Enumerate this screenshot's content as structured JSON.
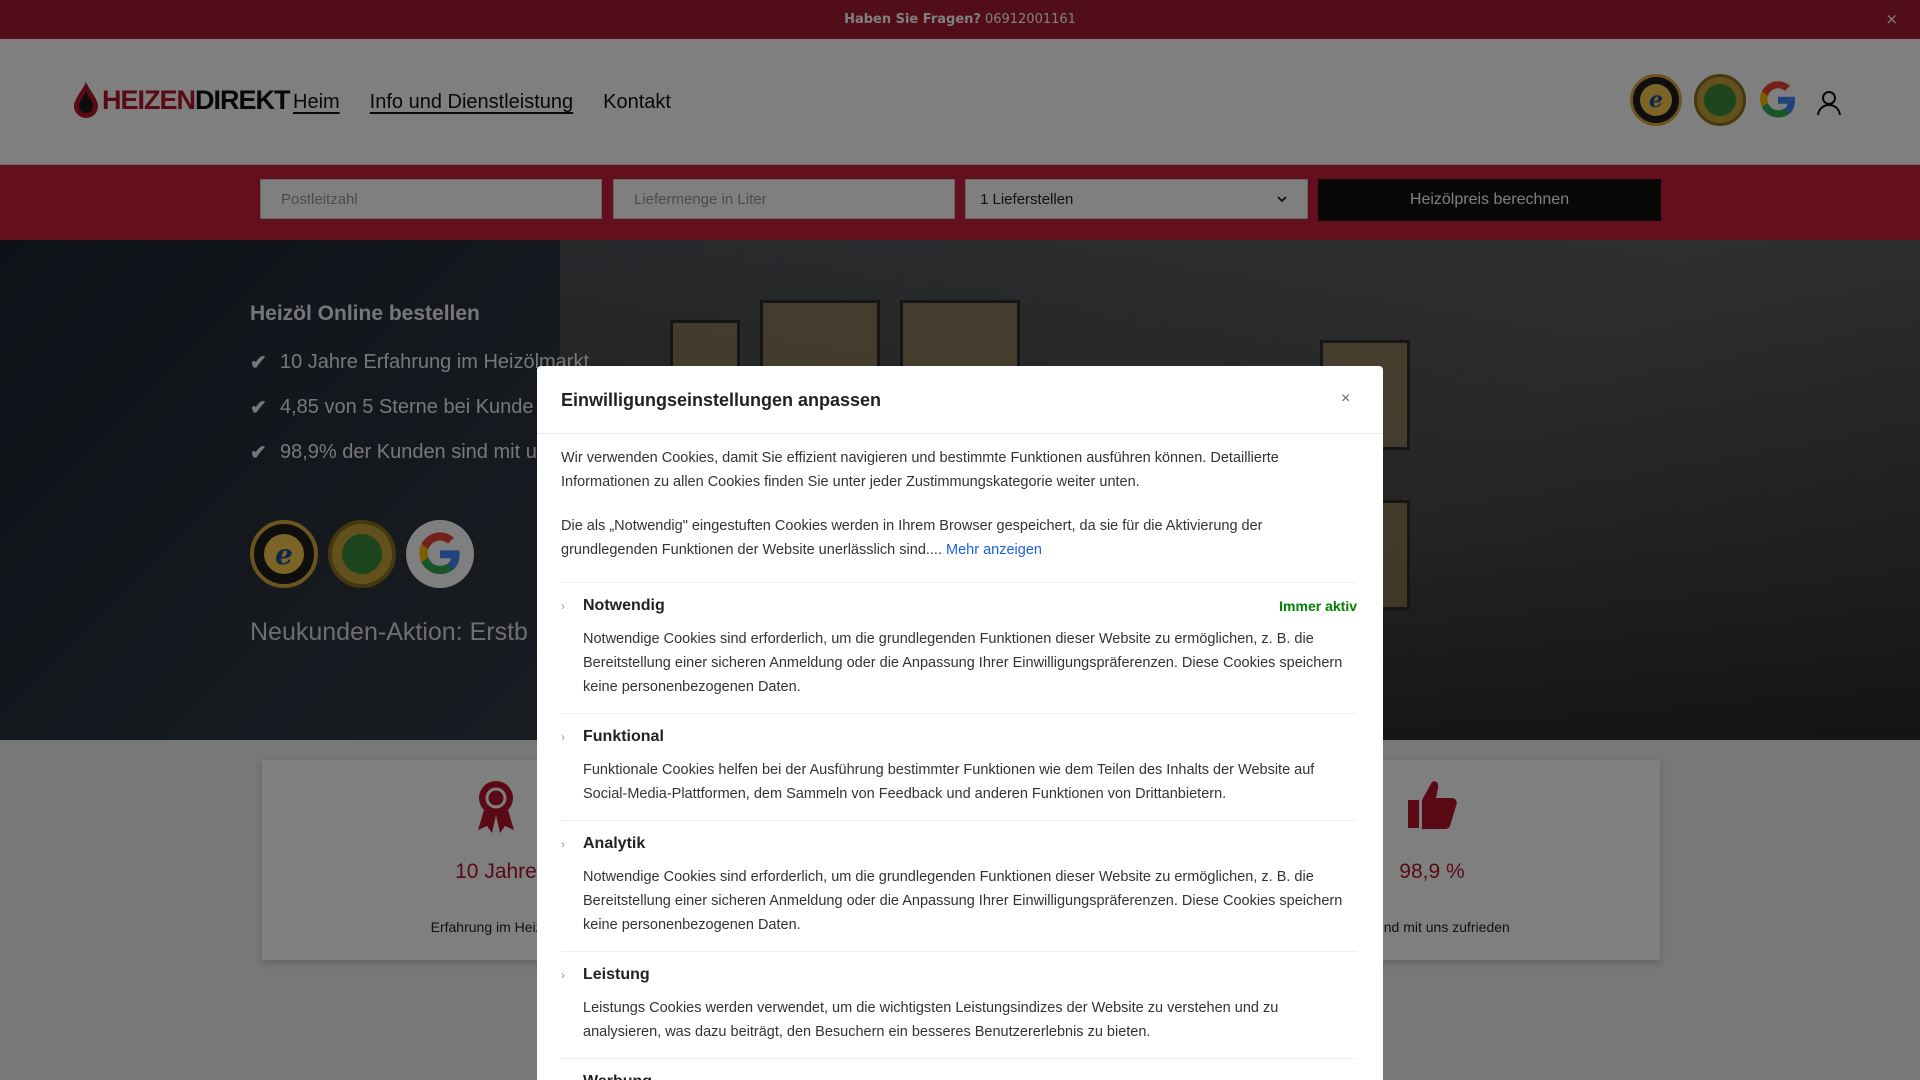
{
  "topbar": {
    "question": "Haben Sie Fragen?",
    "phone": "06912001161",
    "close": "×"
  },
  "header": {
    "brand_part1": "HEIZEN",
    "brand_part2": "DIREKT",
    "nav": [
      {
        "label": "Heim"
      },
      {
        "label": "Info und Dienstleistung"
      },
      {
        "label": "Kontakt"
      }
    ]
  },
  "search": {
    "zip_placeholder": "Postleitzahl",
    "amount_placeholder": "Liefermenge in Liter",
    "delivery_points": "1 Lieferstellen",
    "button": "Heizölpreis berechnen"
  },
  "hero": {
    "heading": "Heizöl Online bestellen",
    "bullets": [
      "10 Jahre Erfahrung im Heizölmarkt",
      "4,85 von 5 Sterne bei Kunde",
      "98,9% der Kunden sind mit u"
    ],
    "promo": "Neukunden-Aktion: Erstb",
    "check": "✔"
  },
  "stats": [
    {
      "value": "10 Jahre",
      "desc": "Erfahrung im Heizöln"
    },
    {
      "value": "98,9 %",
      "desc": "en sind mit uns zufrieden"
    }
  ],
  "modal": {
    "title": "Einwilligungseinstellungen anpassen",
    "close": "×",
    "intro1": "Wir verwenden Cookies, damit Sie effizient navigieren und bestimmte Funktionen ausführen können. Detaillierte Informationen zu allen Cookies finden Sie unter jeder Zustimmungskategorie weiter unten.",
    "intro2": "Die als „Notwendig\" eingestuften Cookies werden in Ihrem Browser gespeichert, da sie für die Aktivierung der grundlegenden Funktionen der Website unerlässlich sind....",
    "more": "Mehr anzeigen",
    "always_active": "Immer aktiv",
    "categories": [
      {
        "name": "Notwendig",
        "desc": "Notwendige Cookies sind erforderlich, um die grundlegenden Funktionen dieser Website zu ermöglichen, z. B. die Bereitstellung einer sicheren Anmeldung oder die Anpassung Ihrer Einwilligungspräferenzen. Diese Cookies speichern keine personenbezogenen Daten."
      },
      {
        "name": "Funktional",
        "desc": "Funktionale Cookies helfen bei der Ausführung bestimmter Funktionen wie dem Teilen des Inhalts der Website auf Social-Media-Plattformen, dem Sammeln von Feedback und anderen Funktionen von Drittanbietern."
      },
      {
        "name": "Analytik",
        "desc": "Notwendige Cookies sind erforderlich, um die grundlegenden Funktionen dieser Website zu ermöglichen, z. B. die Bereitstellung einer sicheren Anmeldung oder die Anpassung Ihrer Einwilligungspräferenzen. Diese Cookies speichern keine personenbezogenen Daten."
      },
      {
        "name": "Leistung",
        "desc": "Leistungs Cookies werden verwendet, um die wichtigsten Leistungsindizes der Website zu verstehen und zu analysieren, was dazu beiträgt, den Besuchern ein besseres Benutzererlebnis zu bieten."
      },
      {
        "name": "Werbung",
        "desc": ""
      }
    ]
  },
  "colors": {
    "topbar": "#a51d31",
    "searchbar": "#c61e3a",
    "brand_red": "#b3142b",
    "link_blue": "#1863dc",
    "active_green": "#008000"
  }
}
